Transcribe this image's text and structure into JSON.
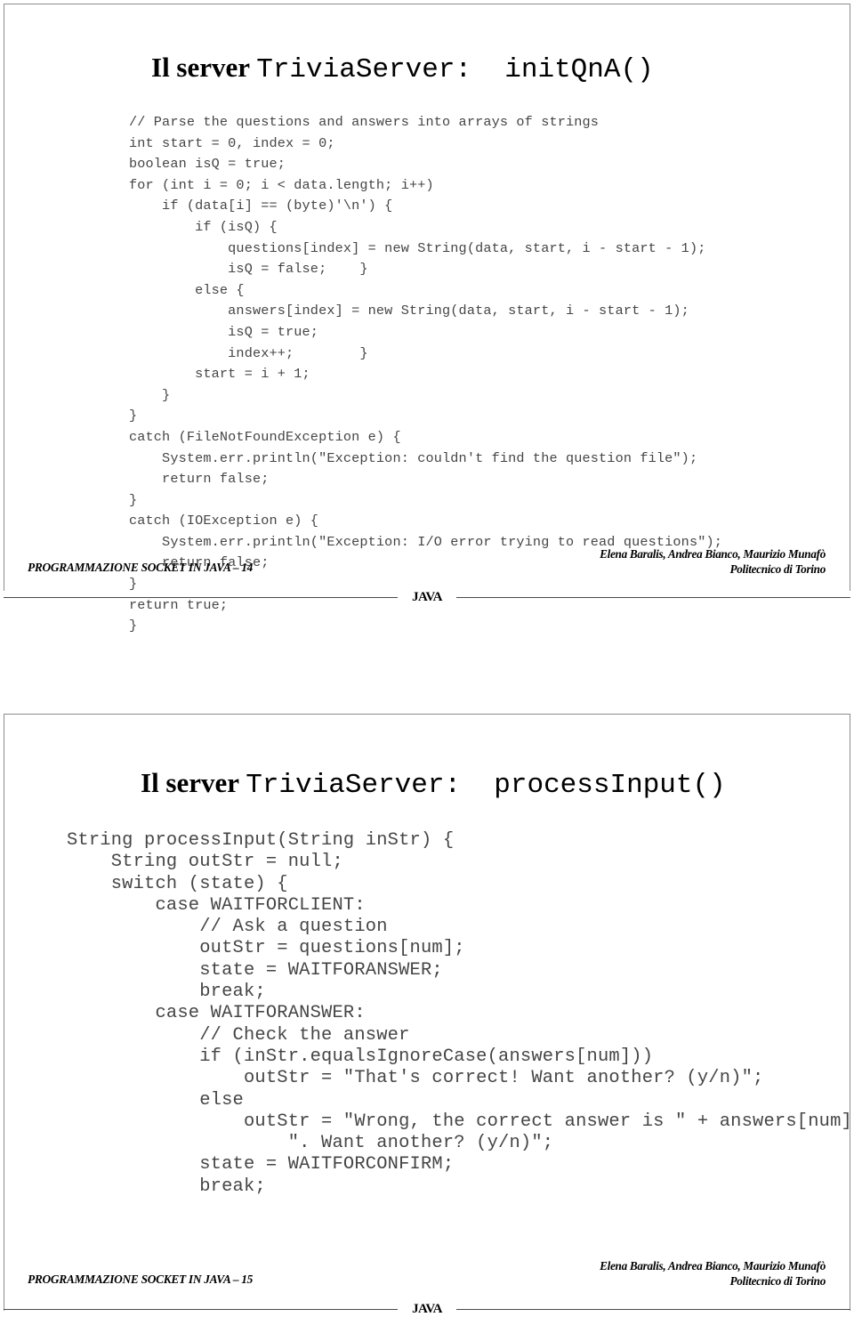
{
  "document": {
    "kind": "lecture-slides",
    "course": "PROGRAMMAZIONE SOCKET IN JAVA"
  },
  "slides": [
    {
      "title": {
        "prefix": "Il server ",
        "code": "TriviaServer:  initQnA()"
      },
      "code": "// Parse the questions and answers into arrays of strings\nint start = 0, index = 0;\nboolean isQ = true;\nfor (int i = 0; i < data.length; i++)\n    if (data[i] == (byte)'\\n') {\n        if (isQ) {\n            questions[index] = new String(data, start, i - start - 1);\n            isQ = false;    }\n        else {\n            answers[index] = new String(data, start, i - start - 1);\n            isQ = true;\n            index++;        }\n        start = i + 1;\n    }\n}\ncatch (FileNotFoundException e) {\n    System.err.println(\"Exception: couldn't find the question file\");\n    return false;\n}\ncatch (IOException e) {\n    System.err.println(\"Exception: I/O error trying to read questions\");\n    return false;\n}\nreturn true;\n}",
      "footer": {
        "left": "PROGRAMMAZIONE SOCKET IN JAVA – 14",
        "authors": "Elena Baralis, Andrea Bianco, Maurizio Munafò",
        "affiliation": "Politecnico di Torino",
        "divider_label": "JAVA"
      }
    },
    {
      "title": {
        "prefix": "Il server ",
        "code": "TriviaServer:  processInput()"
      },
      "code": "String processInput(String inStr) {\n    String outStr = null;\n    switch (state) {\n        case WAITFORCLIENT:\n            // Ask a question\n            outStr = questions[num];\n            state = WAITFORANSWER;\n            break;\n        case WAITFORANSWER:\n            // Check the answer\n            if (inStr.equalsIgnoreCase(answers[num]))\n                outStr = \"That's correct! Want another? (y/n)\";\n            else\n                outStr = \"Wrong, the correct answer is \" + answers[num] +\n                    \". Want another? (y/n)\";\n            state = WAITFORCONFIRM;\n            break;",
      "footer": {
        "left": "PROGRAMMAZIONE SOCKET IN JAVA – 15",
        "authors": "Elena Baralis, Andrea Bianco, Maurizio Munafò",
        "affiliation": "Politecnico di Torino",
        "divider_label": "JAVA"
      }
    }
  ],
  "colors": {
    "slide_border": "#8c8c8c",
    "code_text": "#454545",
    "title_text": "#000000",
    "rule": "#4a4a4a"
  }
}
